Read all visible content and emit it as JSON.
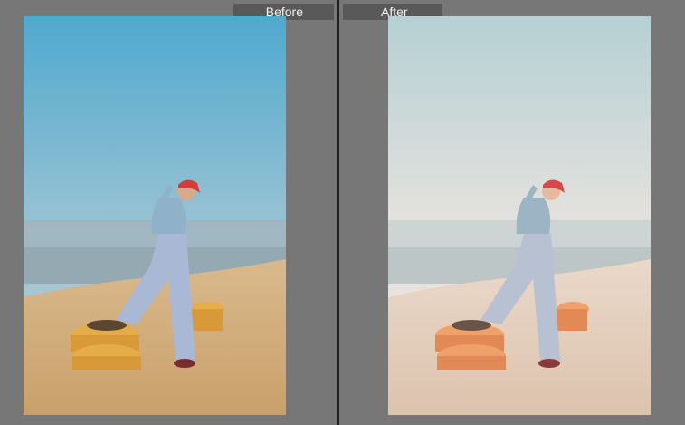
{
  "panes": {
    "before": {
      "label": "Before"
    },
    "after": {
      "label": "After"
    }
  },
  "photos": {
    "before": {
      "description_icon": "woman-on-tires-photo",
      "sky_top": "#56afd0",
      "sky_bottom": "#a9c6d0",
      "ground": "#d7b27c",
      "tire": "#e2a845"
    },
    "after": {
      "description_icon": "woman-on-tires-photo",
      "sky_top": "#b7d1d3",
      "sky_bottom": "#e9e2dc",
      "ground": "#e6d2c2",
      "tire": "#e89b66"
    }
  }
}
